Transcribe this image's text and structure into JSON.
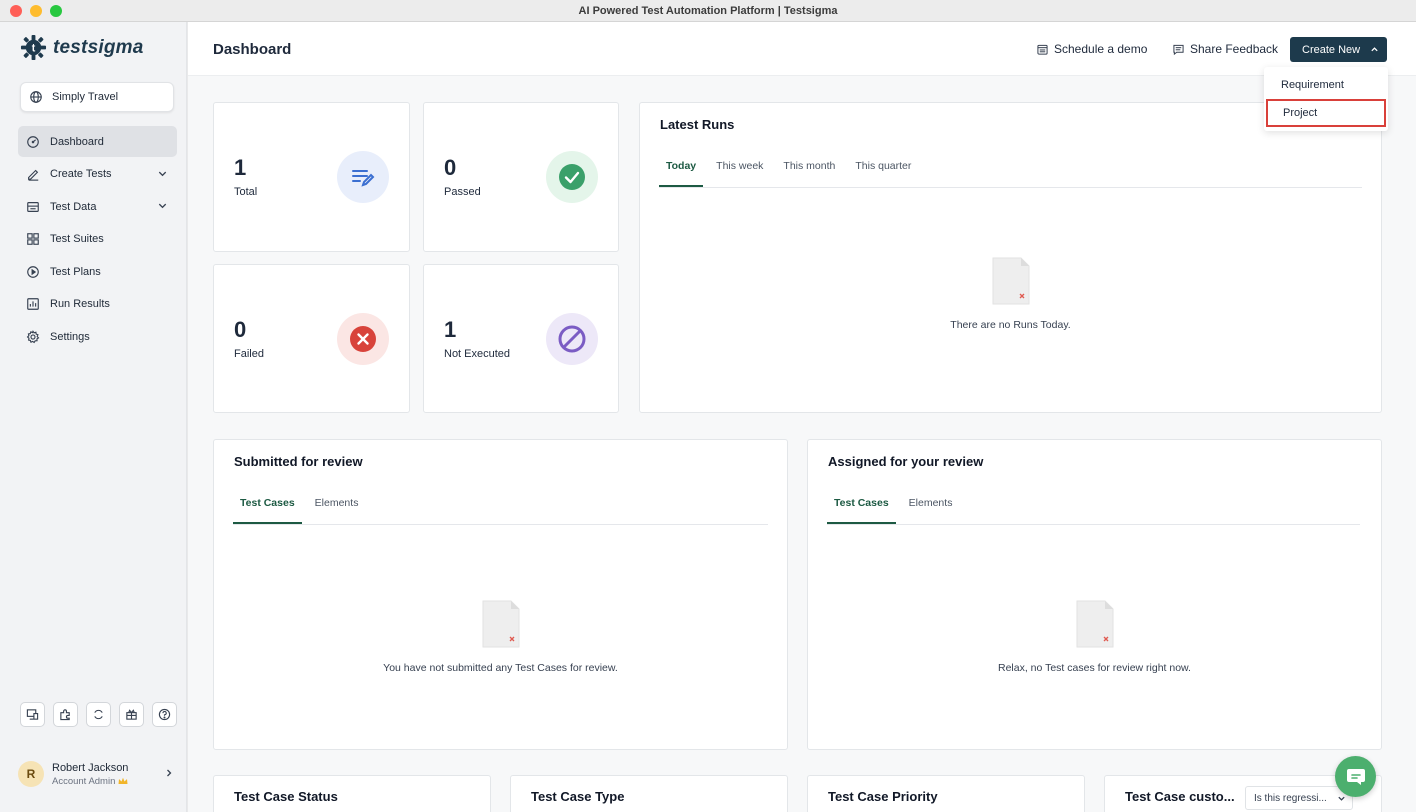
{
  "window": {
    "title": "AI Powered Test Automation Platform | Testsigma"
  },
  "brand": {
    "name": "testsigma"
  },
  "project": {
    "name": "Simply Travel"
  },
  "sidebar": {
    "items": [
      {
        "label": "Dashboard",
        "icon": "gauge-icon"
      },
      {
        "label": "Create Tests",
        "icon": "pencil-icon"
      },
      {
        "label": "Test Data",
        "icon": "table-icon"
      },
      {
        "label": "Test Suites",
        "icon": "grid-icon"
      },
      {
        "label": "Test Plans",
        "icon": "play-circle-icon"
      },
      {
        "label": "Run Results",
        "icon": "bar-chart-icon"
      },
      {
        "label": "Settings",
        "icon": "gear-icon"
      }
    ],
    "tools": [
      "screen-icon",
      "puzzle-icon",
      "circle-arrows-icon",
      "gift-icon",
      "help-icon"
    ]
  },
  "user": {
    "initial": "R",
    "name": "Robert Jackson",
    "role": "Account Admin"
  },
  "header": {
    "title": "Dashboard",
    "schedule": "Schedule a demo",
    "feedback": "Share Feedback",
    "create": "Create New",
    "dropdown": [
      "Requirement",
      "Project"
    ]
  },
  "stats": [
    {
      "value": "1",
      "label": "Total"
    },
    {
      "value": "0",
      "label": "Passed"
    },
    {
      "value": "0",
      "label": "Failed"
    },
    {
      "value": "1",
      "label": "Not Executed"
    }
  ],
  "latest_runs": {
    "title": "Latest Runs",
    "tabs": [
      "Today",
      "This week",
      "This month",
      "This quarter"
    ],
    "empty": "There are no Runs Today."
  },
  "submitted": {
    "title": "Submitted for review",
    "tabs": [
      "Test Cases",
      "Elements"
    ],
    "empty": "You have not submitted any Test Cases for review."
  },
  "assigned": {
    "title": "Assigned for your review",
    "tabs": [
      "Test Cases",
      "Elements"
    ],
    "empty": "Relax, no Test cases for review right now."
  },
  "bottom_cards": {
    "status": "Test Case Status",
    "type": "Test Case Type",
    "priority": "Test Case Priority",
    "custom": "Test Case custo...",
    "custom_select": "Is this regressi..."
  },
  "colors": {
    "brand_dark": "#1d3a4c",
    "tab_active": "#1d5a43",
    "passed": "#3aa06a",
    "failed": "#d8433b",
    "not_executed": "#7b5cc4",
    "total": "#3b6fd1",
    "highlight": "#d9403a"
  }
}
